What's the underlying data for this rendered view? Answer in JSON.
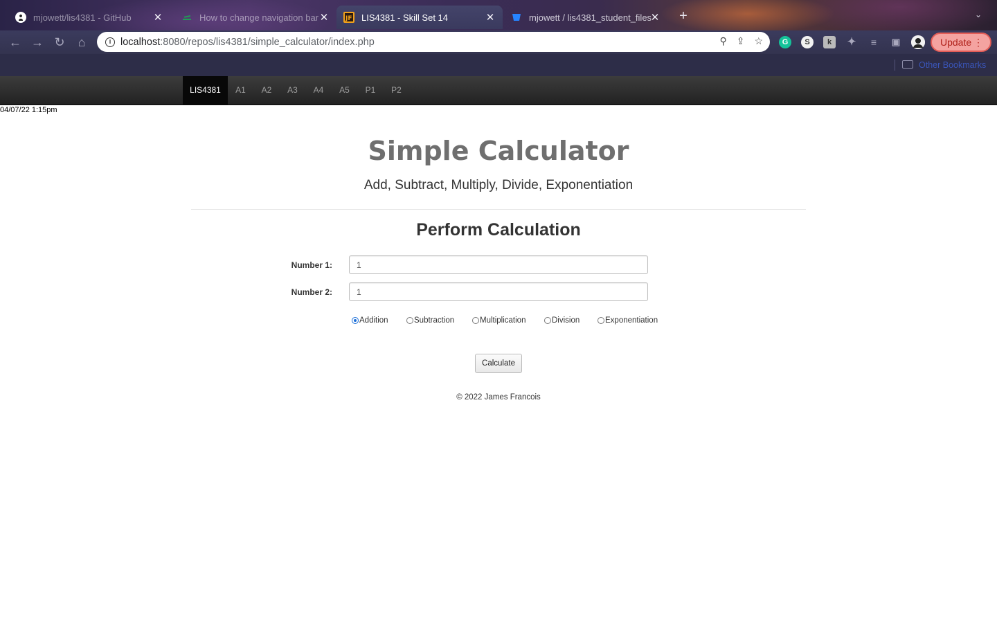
{
  "browser": {
    "tabs": [
      {
        "title": "mjowett/lis4381 - GitHub",
        "favicon": "github-icon",
        "active": false
      },
      {
        "title": "How to change navigation bar",
        "favicon": "stackoverflow-icon",
        "active": false
      },
      {
        "title": "LIS4381 - Skill Set 14",
        "favicon": "jf-logo-icon",
        "active": true
      },
      {
        "title": "mjowett / lis4381_student_files",
        "favicon": "bitbucket-icon",
        "active": false
      }
    ],
    "new_tab": "+",
    "url_host": "localhost",
    "url_rest": ":8080/repos/lis4381/simple_calculator/index.php",
    "update_label": "Update",
    "bookmarks_folder": "Other Bookmarks",
    "colors": {
      "update_bg": "#f4a3a0",
      "update_border": "#e35d57"
    }
  },
  "nav": {
    "brand": "LIS4381",
    "items": [
      "A1",
      "A2",
      "A3",
      "A4",
      "A5",
      "P1",
      "P2"
    ]
  },
  "page": {
    "timestamp": "04/07/22 1:15pm",
    "title": "Simple Calculator",
    "subtitle": "Add, Subtract, Multiply, Divide, Exponentiation",
    "form_title": "Perform Calculation",
    "number1_label": "Number 1:",
    "number1_value": "1",
    "number2_label": "Number 2:",
    "number2_value": "1",
    "operations": [
      {
        "label": "Addition",
        "checked": true
      },
      {
        "label": "Subtraction",
        "checked": false
      },
      {
        "label": "Multiplication",
        "checked": false
      },
      {
        "label": "Division",
        "checked": false
      },
      {
        "label": "Exponentiation",
        "checked": false
      }
    ],
    "calculate_label": "Calculate",
    "footer": "© 2022 James Francois"
  }
}
